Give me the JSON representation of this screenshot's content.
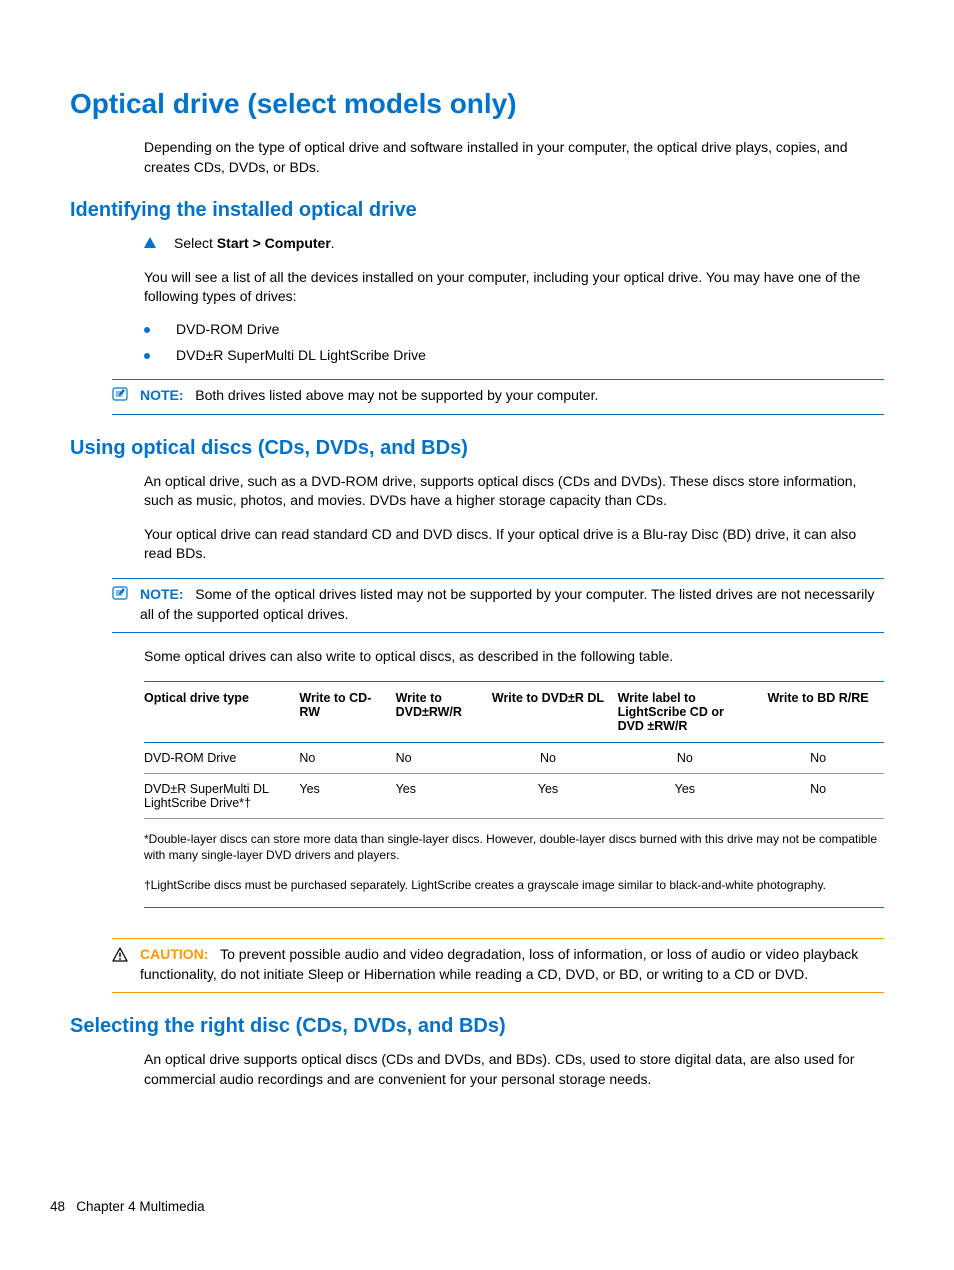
{
  "title": "Optical drive (select models only)",
  "intro": "Depending on the type of optical drive and software installed in your computer, the optical drive plays, copies, and creates CDs, DVDs, or BDs.",
  "section1": {
    "heading": "Identifying the installed optical drive",
    "step_prefix": "Select ",
    "step_bold": "Start > Computer",
    "step_suffix": ".",
    "after_step": "You will see a list of all the devices installed on your computer, including your optical drive. You may have one of the following types of drives:",
    "bullets": [
      "DVD-ROM Drive",
      "DVD±R SuperMulti DL LightScribe Drive"
    ],
    "note_label": "NOTE:",
    "note_text": "Both drives listed above may not be supported by your computer."
  },
  "section2": {
    "heading": "Using optical discs (CDs, DVDs, and BDs)",
    "p1": "An optical drive, such as a DVD-ROM drive, supports optical discs (CDs and DVDs). These discs store information, such as music, photos, and movies. DVDs have a higher storage capacity than CDs.",
    "p2": "Your optical drive can read standard CD and DVD discs. If your optical drive is a Blu-ray Disc (BD) drive, it can also read BDs.",
    "note_label": "NOTE:",
    "note_text": "Some of the optical drives listed may not be supported by your computer. The listed drives are not necessarily all of the supported optical drives.",
    "p3": "Some optical drives can also write to optical discs, as described in the following table.",
    "table": {
      "headers": [
        "Optical drive type",
        "Write to CD-RW",
        "Write to DVD±RW/R",
        "Write to DVD±R DL",
        "Write label to LightScribe CD or DVD ±RW/R",
        "Write to BD R/RE"
      ],
      "rows": [
        [
          "DVD-ROM Drive",
          "No",
          "No",
          "No",
          "No",
          "No"
        ],
        [
          "DVD±R SuperMulti DL LightScribe Drive*†",
          "Yes",
          "Yes",
          "Yes",
          "Yes",
          "No"
        ]
      ]
    },
    "footnote1": "*Double-layer discs can store more data than single-layer discs. However, double-layer discs burned with this drive may not be compatible with many single-layer DVD drivers and players.",
    "footnote2": "†LightScribe discs must be purchased separately. LightScribe creates a grayscale image similar to black-and-white photography.",
    "caution_label": "CAUTION:",
    "caution_text": "To prevent possible audio and video degradation, loss of information, or loss of audio or video playback functionality, do not initiate Sleep or Hibernation while reading a CD, DVD, or BD, or writing to a CD or DVD."
  },
  "section3": {
    "heading": "Selecting the right disc (CDs, DVDs, and BDs)",
    "p1": "An optical drive supports optical discs (CDs and DVDs, and BDs). CDs, used to store digital data, are also used for commercial audio recordings and are convenient for your personal storage needs."
  },
  "footer": {
    "page": "48",
    "chapter": "Chapter 4   Multimedia"
  }
}
